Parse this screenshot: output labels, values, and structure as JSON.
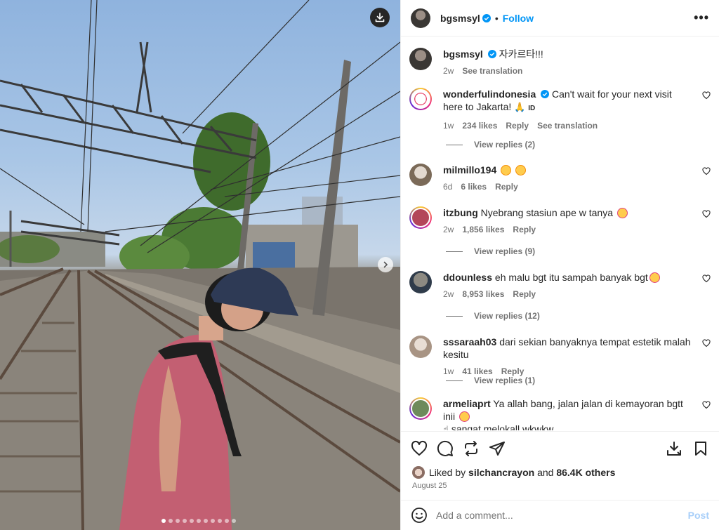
{
  "post": {
    "author": "bgsmsyl",
    "follow_label": "Follow",
    "more_label": "•••",
    "dot": "•"
  },
  "caption": {
    "author": "bgsmsyl",
    "text": "자카르타!!!",
    "time": "2w",
    "translate": "See translation"
  },
  "comments": [
    {
      "author": "wonderfulindonesia",
      "verified": true,
      "text": "Can't wait for your next visit here to Jakarta!",
      "suffix": "ID",
      "time": "1w",
      "likes": "234 likes",
      "reply": "Reply",
      "translate": "See translation",
      "replies": "View replies (2)"
    },
    {
      "author": "milmillo194",
      "text": "",
      "time": "6d",
      "likes": "6 likes",
      "reply": "Reply"
    },
    {
      "author": "itzbung",
      "text": "Nyebrang stasiun ape w tanya",
      "time": "2w",
      "likes": "1,856 likes",
      "reply": "Reply",
      "replies": "View replies (9)"
    },
    {
      "author": "ddounless",
      "text": "eh malu bgt itu sampah banyak bgt",
      "time": "2w",
      "likes": "8,953 likes",
      "reply": "Reply",
      "replies": "View replies (12)"
    },
    {
      "author": "sssaraah03",
      "text": "dari sekian banyaknya tempat estetik malah kesitu",
      "time": "1w",
      "likes": "41 likes",
      "reply": "Reply",
      "replies": "View replies (1)"
    },
    {
      "author": "armeliaprt",
      "text": "Ya allah bang, jalan jalan di kemayoran bgtt inii",
      "text2": "sangat melokall wkwkw"
    }
  ],
  "likes_line": {
    "prefix": "Liked by",
    "user": "silchancrayon",
    "and": "and",
    "others": "86.4K others"
  },
  "date": "August 25",
  "add_comment": {
    "placeholder": "Add a comment...",
    "post_label": "Post"
  },
  "carousel": {
    "slides": 11,
    "active": 0
  },
  "colors": {
    "accent": "#0095f6",
    "muted": "#737373",
    "text": "#262626",
    "post_disabled": "#a8cff9"
  }
}
